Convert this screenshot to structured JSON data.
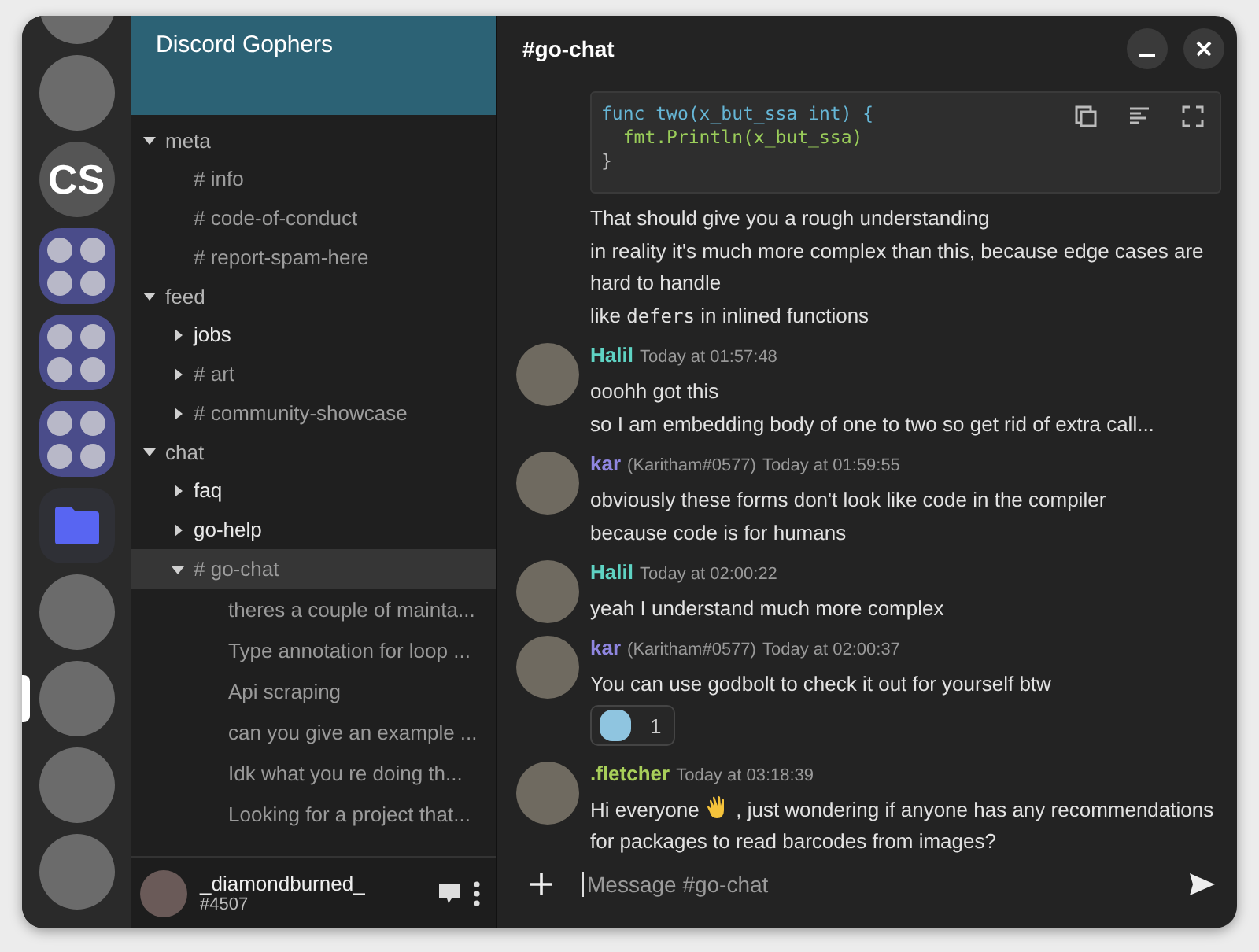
{
  "servers": [
    {
      "kind": "image",
      "selected": false
    },
    {
      "kind": "image",
      "selected": false
    },
    {
      "kind": "text",
      "label": "CS",
      "selected": false
    },
    {
      "kind": "folder",
      "selected": false
    },
    {
      "kind": "folder",
      "selected": false
    },
    {
      "kind": "folder",
      "selected": false
    },
    {
      "kind": "directory",
      "selected": false
    },
    {
      "kind": "image",
      "selected": false
    },
    {
      "kind": "image",
      "selected": true
    },
    {
      "kind": "image",
      "selected": false
    },
    {
      "kind": "image",
      "selected": false
    }
  ],
  "guild": {
    "name": "Discord Gophers"
  },
  "categories": [
    {
      "name": "meta",
      "expanded": true,
      "channels": [
        {
          "prefix": "#",
          "name": "info",
          "kind": "text",
          "unread": false,
          "selected": false
        },
        {
          "prefix": "#",
          "name": "code-of-conduct",
          "kind": "text",
          "unread": false,
          "selected": false
        },
        {
          "prefix": "#",
          "name": "report-spam-here",
          "kind": "text",
          "unread": false,
          "selected": false
        }
      ]
    },
    {
      "name": "feed",
      "expanded": true,
      "channels": [
        {
          "name": "jobs",
          "kind": "forum",
          "expanded": false,
          "unread": true,
          "selected": false
        },
        {
          "prefix": "#",
          "name": "art",
          "kind": "forum",
          "expanded": false,
          "unread": false,
          "selected": false
        },
        {
          "prefix": "#",
          "name": "community-showcase",
          "kind": "forum",
          "expanded": false,
          "unread": false,
          "selected": false
        }
      ]
    },
    {
      "name": "chat",
      "expanded": true,
      "channels": [
        {
          "name": "faq",
          "kind": "forum",
          "expanded": false,
          "unread": true,
          "selected": false
        },
        {
          "name": "go-help",
          "kind": "forum",
          "expanded": false,
          "unread": true,
          "selected": false
        },
        {
          "prefix": "#",
          "name": "go-chat",
          "kind": "forum",
          "expanded": true,
          "unread": false,
          "selected": true,
          "children": [
            {
              "name": "theres a couple of mainta..."
            },
            {
              "name": "Type annotation for loop ..."
            },
            {
              "name": "Api scraping"
            },
            {
              "name": "can you give an example ..."
            },
            {
              "name": "Idk what you re doing th..."
            },
            {
              "name": "Looking for a project that..."
            }
          ]
        }
      ]
    }
  ],
  "user": {
    "name": "_diamondburned_",
    "tag": "#4507"
  },
  "chat": {
    "title": "#go-chat"
  },
  "messages": [
    {
      "header": false,
      "blocks": [
        {
          "kind": "code",
          "lines": [
            "func two(x_but_ssa int) {",
            "  fmt.Println(x_but_ssa)",
            "}"
          ]
        },
        {
          "kind": "text",
          "parts": [
            {
              "kind": "plain",
              "text": "That should give you a rough understanding"
            }
          ]
        },
        {
          "kind": "text",
          "parts": [
            {
              "kind": "plain",
              "text": "in reality it's much more complex than this, because edge cases are hard to handle"
            }
          ]
        },
        {
          "kind": "text",
          "parts": [
            {
              "kind": "plain",
              "text": "like "
            },
            {
              "kind": "code",
              "text": "defers"
            },
            {
              "kind": "plain",
              "text": " in inlined functions"
            }
          ]
        }
      ]
    },
    {
      "header": true,
      "author": "Halil",
      "color": "#5fd3c3",
      "time": "Today at 01:57:48",
      "blocks": [
        {
          "kind": "text",
          "parts": [
            {
              "kind": "plain",
              "text": "ooohh got this"
            }
          ]
        },
        {
          "kind": "text",
          "parts": [
            {
              "kind": "plain",
              "text": "so I am embedding body of one to two so get rid of extra call..."
            }
          ]
        }
      ]
    },
    {
      "header": true,
      "author": "kar",
      "color": "#8f86e0",
      "tag": "(Karitham#0577)",
      "time": "Today at 01:59:55",
      "blocks": [
        {
          "kind": "text",
          "parts": [
            {
              "kind": "plain",
              "text": "obviously these forms don't look like code in the compiler"
            }
          ]
        },
        {
          "kind": "text",
          "parts": [
            {
              "kind": "plain",
              "text": "because code is for humans"
            }
          ]
        }
      ]
    },
    {
      "header": true,
      "author": "Halil",
      "color": "#5fd3c3",
      "time": "Today at 02:00:22",
      "blocks": [
        {
          "kind": "text",
          "parts": [
            {
              "kind": "plain",
              "text": "yeah I understand much more complex"
            }
          ]
        }
      ]
    },
    {
      "header": true,
      "author": "kar",
      "color": "#8f86e0",
      "tag": "(Karitham#0577)",
      "time": "Today at 02:00:37",
      "blocks": [
        {
          "kind": "text",
          "parts": [
            {
              "kind": "plain",
              "text": "You can use godbolt to check it out for yourself btw"
            }
          ]
        },
        {
          "kind": "reaction",
          "count": "1"
        }
      ]
    },
    {
      "header": true,
      "author": ".fletcher",
      "color": "#a8cf5a",
      "time": "Today at 03:18:39",
      "blocks": [
        {
          "kind": "text",
          "parts": [
            {
              "kind": "plain",
              "text": "Hi everyone "
            },
            {
              "kind": "emoji"
            },
            {
              "kind": "plain",
              "text": " , just wondering if anyone has any recommendations for packages to read barcodes from images?"
            }
          ]
        }
      ]
    }
  ],
  "composer": {
    "placeholder": "Message #go-chat"
  }
}
